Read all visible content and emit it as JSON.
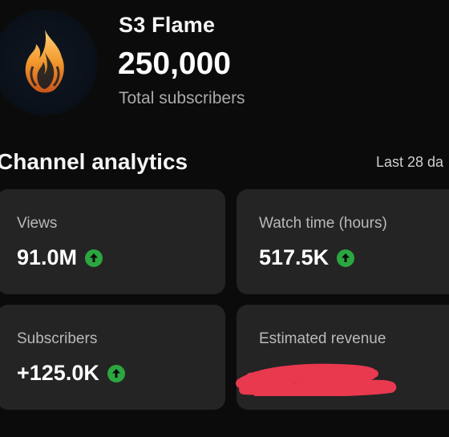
{
  "channel": {
    "name": "S3 Flame",
    "subscriber_count": "250,000",
    "subscriber_label": "Total subscribers",
    "avatar_icon": "flame-logo"
  },
  "analytics": {
    "title": "Channel analytics",
    "period": "Last 28 da",
    "cards": [
      {
        "label": "Views",
        "value": "91.0M",
        "trend": "up"
      },
      {
        "label": "Watch time (hours)",
        "value": "517.5K",
        "trend": "up"
      },
      {
        "label": "Subscribers",
        "value": "+125.0K",
        "trend": "up"
      },
      {
        "label": "Estimated revenue",
        "value": "",
        "redacted": true
      }
    ]
  },
  "colors": {
    "background": "#0b0b0b",
    "card": "#242424",
    "trend_up": "#2ba640",
    "redaction": "#e8394f"
  }
}
